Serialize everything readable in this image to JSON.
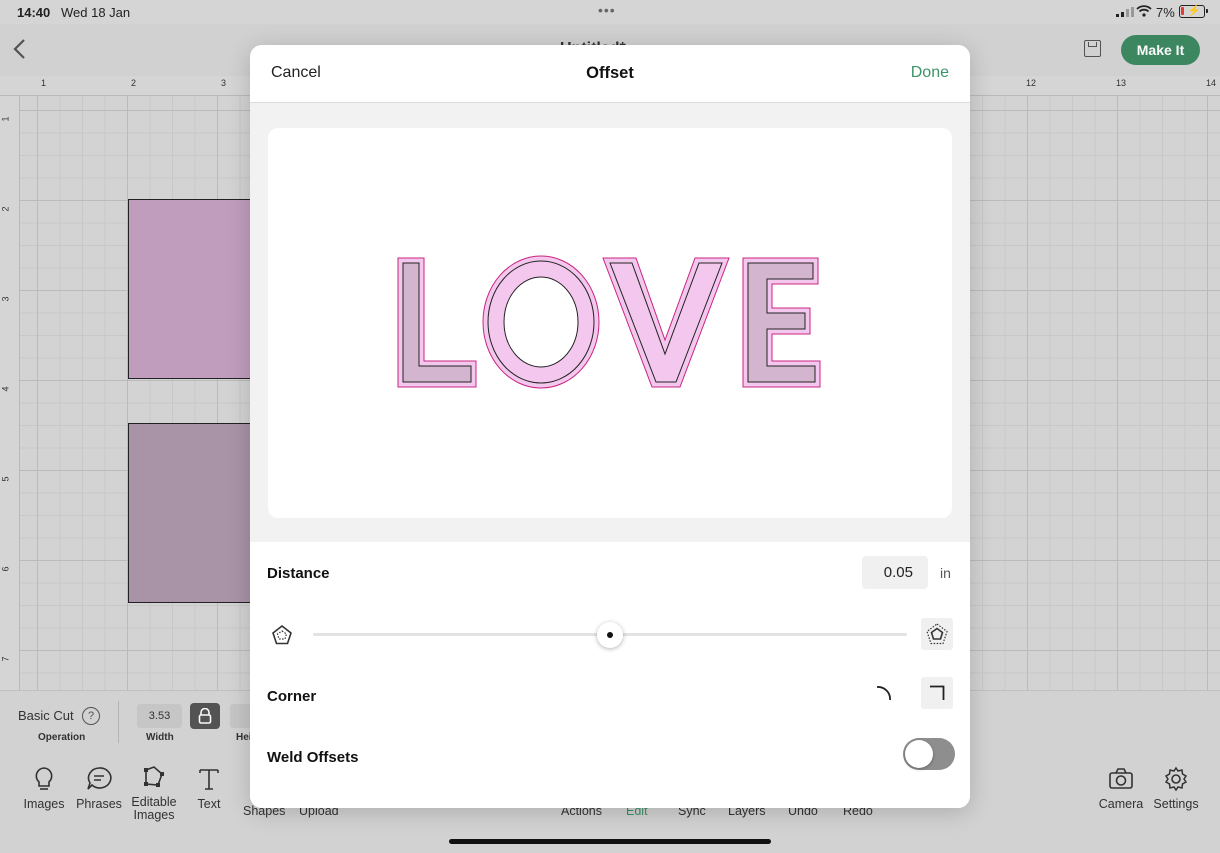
{
  "status": {
    "time": "14:40",
    "date": "Wed 18 Jan",
    "battery": "7%"
  },
  "appbar": {
    "title": "Untitled*",
    "make_it": "Make It"
  },
  "rulers": {
    "top": [
      "1",
      "2",
      "3",
      "12",
      "13",
      "14"
    ],
    "left": [
      "1",
      "2",
      "3",
      "4",
      "5",
      "6",
      "7"
    ]
  },
  "props": {
    "operation_value": "Basic Cut",
    "operation_caption": "Operation",
    "width_value": "3.53",
    "width_caption": "Width",
    "height_caption": "Hei"
  },
  "toolbar": {
    "images": "Images",
    "phrases": "Phrases",
    "editable_images": "Editable Images",
    "text": "Text",
    "shapes": "Shapes",
    "upload": "Upload",
    "actions": "Actions",
    "edit": "Edit",
    "sync": "Sync",
    "layers": "Layers",
    "undo": "Undo",
    "redo": "Redo",
    "camera": "Camera",
    "settings": "Settings"
  },
  "modal": {
    "cancel": "Cancel",
    "title": "Offset",
    "done": "Done",
    "preview_text": "LOVE",
    "distance_label": "Distance",
    "distance_value": "0.05",
    "distance_unit": "in",
    "slider_value": 0.5,
    "corner_label": "Corner",
    "weld_label": "Weld Offsets",
    "weld_on": false
  },
  "colors": {
    "accent_green": "#3e8a62",
    "offset_outline": "#c8267f",
    "letter_fill_pink": "#f4c8ee",
    "letter_fill_mauve": "#d4b5cf"
  }
}
